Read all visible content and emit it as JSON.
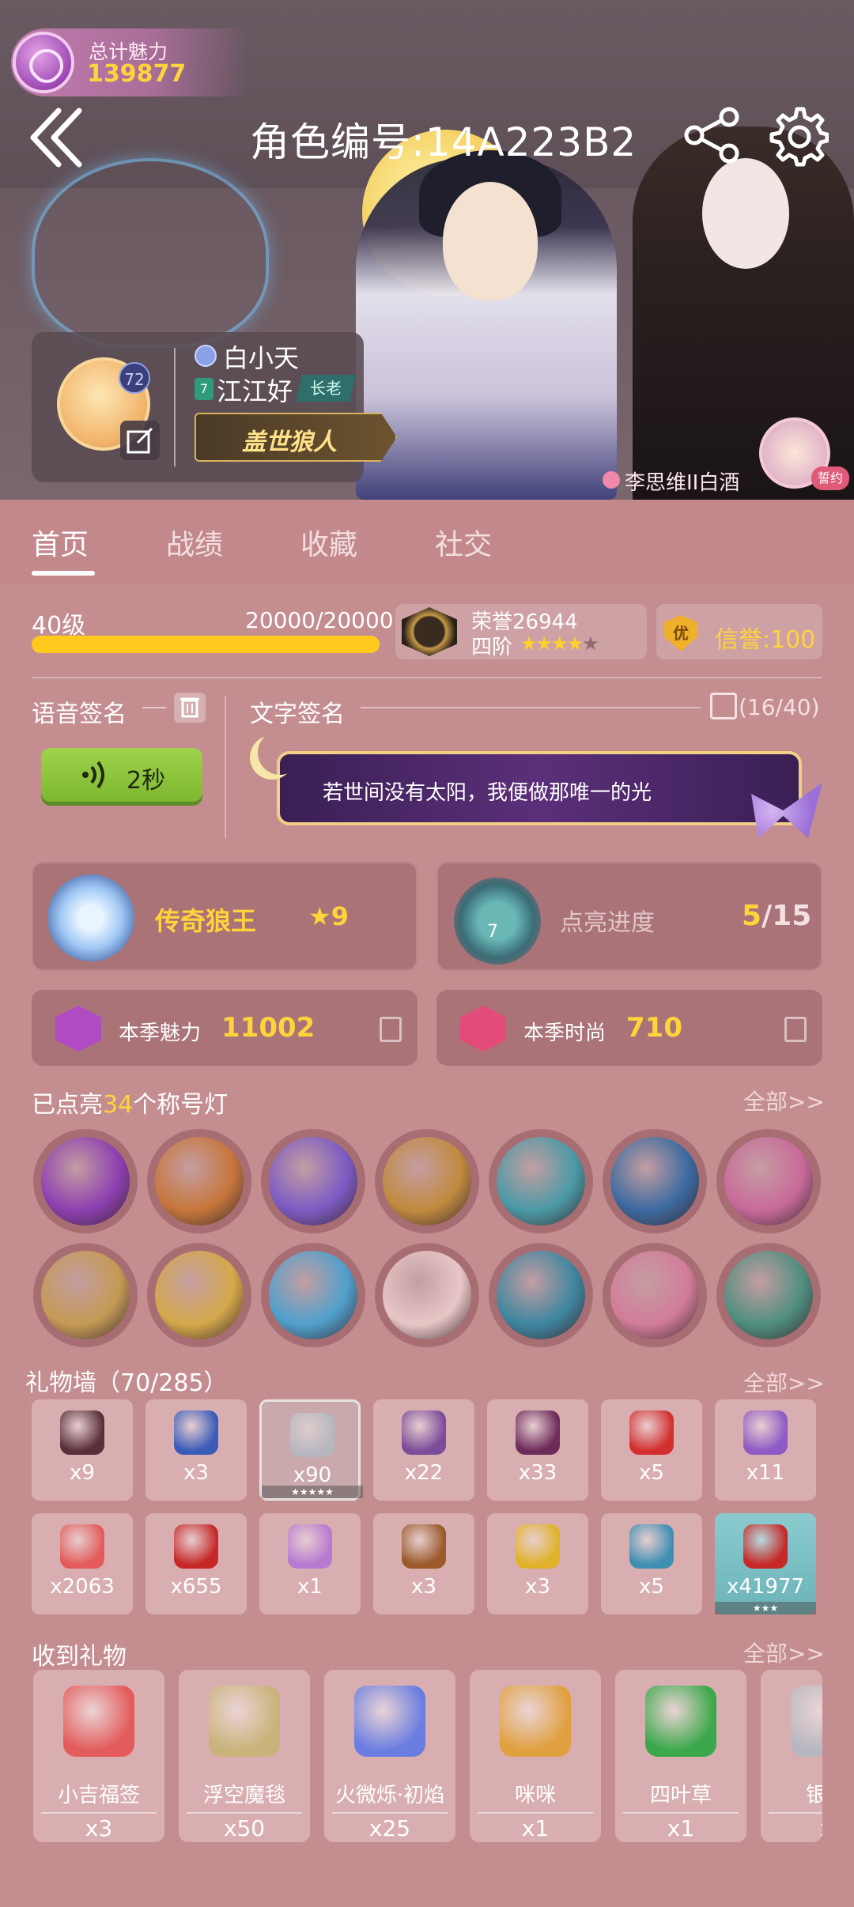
{
  "charm": {
    "label": "总计魅力",
    "value": "139877"
  },
  "header": {
    "title": "角色编号:14A223B2"
  },
  "profile": {
    "avatar_level": "72",
    "nickname": "白小天",
    "guild_level": "7",
    "guild_name": "江江好",
    "guild_role": "长老",
    "title_badge": "盖世狼人",
    "couple_name": "李思维II白酒",
    "couple_tag": "誓约"
  },
  "tabs": [
    {
      "label": "首页",
      "active": true
    },
    {
      "label": "战绩",
      "active": false
    },
    {
      "label": "收藏",
      "active": false
    },
    {
      "label": "社交",
      "active": false
    }
  ],
  "level": {
    "label": "40级",
    "exp_text": "20000/20000",
    "progress": 1.0
  },
  "honor": {
    "text": "荣誉26944",
    "rank": "四阶",
    "stars_on": 4,
    "stars_total": 5
  },
  "credit": {
    "icon_text": "优",
    "text": "信誉:100"
  },
  "voice_sig": {
    "label": "语音签名",
    "duration": "2秒",
    "icon": "sound-wave-icon"
  },
  "text_sig": {
    "label": "文字签名",
    "count": "(16/40)",
    "text": "若世间没有太阳，我便做那唯一的光"
  },
  "achievement": {
    "title": "传奇狼王",
    "stars": "9"
  },
  "lighting": {
    "level": "7",
    "label": "点亮进度",
    "current": "5",
    "total": "/15"
  },
  "season_charm": {
    "label": "本季魅力",
    "value": "11002"
  },
  "season_fashion": {
    "label": "本季时尚",
    "value": "710"
  },
  "badges_section": {
    "prefix": "已点亮",
    "count": "34",
    "suffix": "个称号灯",
    "more": "全部>>"
  },
  "badges": [
    {
      "name": "purple-vortex-icon",
      "color": "#8d3fb0"
    },
    {
      "name": "werewolf-icon",
      "color": "#c7763b"
    },
    {
      "name": "purple-cards-icon",
      "color": "#7c5bc4"
    },
    {
      "name": "golden-hand-icon",
      "color": "#c08a3e"
    },
    {
      "name": "teal-wolf-icon",
      "color": "#4a9aa6"
    },
    {
      "name": "blue-emblem-icon",
      "color": "#3b6aa0"
    },
    {
      "name": "pink-potion-icon",
      "color": "#c86a9a"
    },
    {
      "name": "shield-sword-icon",
      "color": "#c49a54"
    },
    {
      "name": "blond-hero-icon",
      "color": "#d4a84a"
    },
    {
      "name": "blue-flame-icon",
      "color": "#4fa0cc"
    },
    {
      "name": "love-letter-icon",
      "color": "#e8c6c6"
    },
    {
      "name": "clock-icon",
      "color": "#3e86a0"
    },
    {
      "name": "pink-fan-icon",
      "color": "#d27c9a"
    },
    {
      "name": "green-armor-icon",
      "color": "#4f8f80"
    }
  ],
  "gift_wall": {
    "title": "礼物墙（70/285）",
    "more": "全部>>"
  },
  "gifts": [
    {
      "name": "eye-icon",
      "count": "x9",
      "color": "#5a2f3a"
    },
    {
      "name": "blue-ring-icon",
      "count": "x3",
      "color": "#3a5bb8"
    },
    {
      "name": "silver-bullet-icon",
      "count": "x90",
      "color": "#b7b7bf",
      "selected": true,
      "stars": "★★★★★"
    },
    {
      "name": "purple-earring-icon",
      "count": "x22",
      "color": "#7b4c9a"
    },
    {
      "name": "wine-glass-icon",
      "count": "x33",
      "color": "#6d2b5a"
    },
    {
      "name": "red-envelope-icon",
      "count": "x5",
      "color": "#d32f2f"
    },
    {
      "name": "purple-flower-icon",
      "count": "x11",
      "color": "#8e5ac4"
    },
    {
      "name": "lucky-tag-icon",
      "count": "x2063",
      "color": "#e35b5b"
    },
    {
      "name": "red-charm-icon",
      "count": "x655",
      "color": "#c62828"
    },
    {
      "name": "magic-wand-icon",
      "count": "x1",
      "color": "#b87ad0"
    },
    {
      "name": "treasure-chest-icon",
      "count": "x3",
      "color": "#9a5a2a"
    },
    {
      "name": "gold-crown-icon",
      "count": "x3",
      "color": "#e0b22a"
    },
    {
      "name": "amulet-icon",
      "count": "x5",
      "color": "#3f8fb3"
    },
    {
      "name": "red-rose-icon",
      "count": "x41977",
      "color": "#c62828",
      "rare": true,
      "stars": "★★★"
    }
  ],
  "received": {
    "title": "收到礼物",
    "more": "全部>>"
  },
  "received_items": [
    {
      "name": "lucky-tag-icon",
      "label": "小吉福签",
      "count": "x3",
      "color": "#e35b5b"
    },
    {
      "name": "flying-carpet-icon",
      "label": "浮空魔毯",
      "count": "x50",
      "color": "#c9b37a"
    },
    {
      "name": "blue-flame-spirit-icon",
      "label": "火微烁·初焰",
      "count": "x25",
      "color": "#6a7de0"
    },
    {
      "name": "cat-icon",
      "label": "咪咪",
      "count": "x1",
      "color": "#e0a040"
    },
    {
      "name": "four-leaf-clover-icon",
      "label": "四叶草",
      "count": "x1",
      "color": "#3aa84a"
    },
    {
      "name": "silver-bullet-icon",
      "label": "银子",
      "count": "x",
      "color": "#b7b7bf"
    }
  ]
}
